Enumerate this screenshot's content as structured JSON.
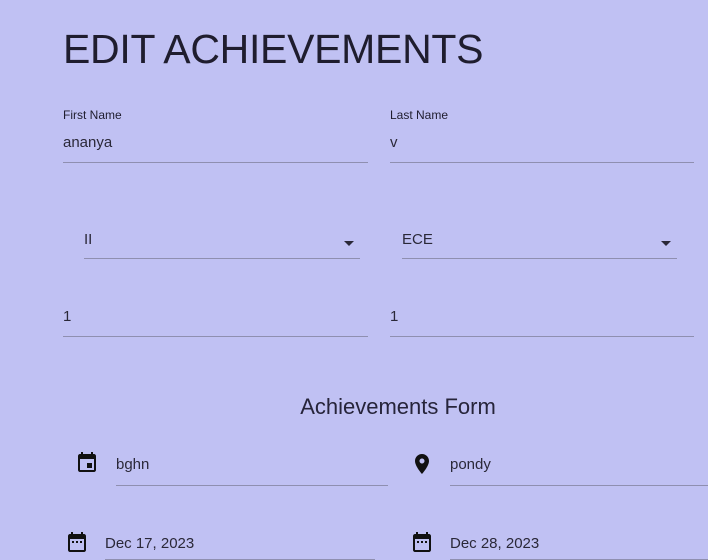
{
  "page": {
    "title": "EDIT ACHIEVEMENTS"
  },
  "student": {
    "first_name": {
      "label": "First Name",
      "value": "ananya"
    },
    "last_name": {
      "label": "Last Name",
      "value": "v"
    },
    "year_select": {
      "value": "II"
    },
    "department_select": {
      "value": "ECE"
    },
    "field_left": {
      "value": "1"
    },
    "field_right": {
      "value": "1"
    }
  },
  "achievements": {
    "section_title": "Achievements Form",
    "event_name": {
      "icon": "event-icon",
      "value": "bghn"
    },
    "location": {
      "icon": "location-pin-icon",
      "value": "pondy"
    },
    "start_date": {
      "icon": "calendar-icon",
      "value": "Dec 17, 2023"
    },
    "end_date": {
      "icon": "calendar-icon",
      "value": "Dec 28, 2023"
    }
  }
}
